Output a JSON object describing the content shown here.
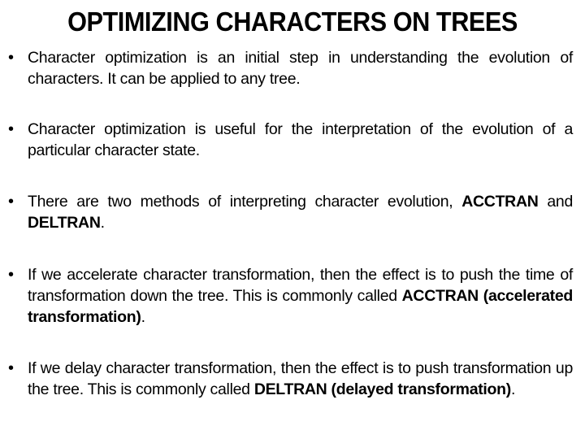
{
  "slide": {
    "title": "OPTIMIZING CHARACTERS ON TREES",
    "bullets": [
      {
        "parts": [
          {
            "text": "Character optimization is an initial step in understanding the evolution of characters. It can be applied to any tree.",
            "bold": false
          }
        ]
      },
      {
        "parts": [
          {
            "text": "Character optimization is useful for the interpretation of the evolution of a particular character state.",
            "bold": false
          }
        ]
      },
      {
        "parts": [
          {
            "text": "There are two methods of interpreting character evolution, ",
            "bold": false
          },
          {
            "text": "ACCTRAN",
            "bold": true
          },
          {
            "text": " and ",
            "bold": false
          },
          {
            "text": "DELTRAN",
            "bold": true
          },
          {
            "text": ".",
            "bold": false
          }
        ]
      },
      {
        "parts": [
          {
            "text": "If we accelerate character transformation, then the effect is to push the time of transformation down the tree. This is commonly called ",
            "bold": false
          },
          {
            "text": "ACCTRAN (accelerated transformation)",
            "bold": true
          },
          {
            "text": ".",
            "bold": false
          }
        ]
      },
      {
        "parts": [
          {
            "text": "If we delay character transformation, then the effect is to push transformation up the tree. This is commonly called ",
            "bold": false
          },
          {
            "text": "DELTRAN (delayed transformation)",
            "bold": true
          },
          {
            "text": ".",
            "bold": false
          }
        ]
      }
    ],
    "bullet_glyph": "•"
  }
}
